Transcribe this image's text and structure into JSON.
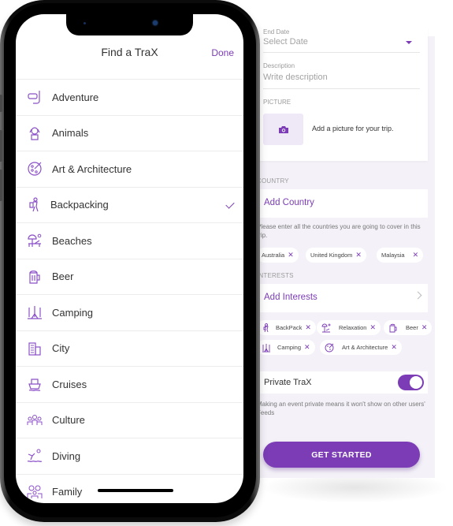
{
  "colors": {
    "accent": "#7b3cb5",
    "background": "#f4f2f8",
    "text": "#333333"
  },
  "picker": {
    "title": "Find a TraX",
    "done_label": "Done",
    "items": [
      {
        "label": "Adventure",
        "icon": "snorkel-mask-icon",
        "selected": false
      },
      {
        "label": "Animals",
        "icon": "dog-icon",
        "selected": false
      },
      {
        "label": "Art & Architecture",
        "icon": "palette-icon",
        "selected": false
      },
      {
        "label": "Backpacking",
        "icon": "backpacker-icon",
        "selected": true
      },
      {
        "label": "Beaches",
        "icon": "beach-umbrella-icon",
        "selected": false
      },
      {
        "label": "Beer",
        "icon": "beer-mug-icon",
        "selected": false
      },
      {
        "label": "Camping",
        "icon": "tent-trees-icon",
        "selected": false
      },
      {
        "label": "City",
        "icon": "buildings-icon",
        "selected": false
      },
      {
        "label": "Cruises",
        "icon": "ship-icon",
        "selected": false
      },
      {
        "label": "Culture",
        "icon": "people-group-icon",
        "selected": false
      },
      {
        "label": "Diving",
        "icon": "diver-icon",
        "selected": false
      },
      {
        "label": "Family",
        "icon": "family-icon",
        "selected": false
      }
    ]
  },
  "form": {
    "end_date": {
      "label": "End Date",
      "placeholder": "Select Date"
    },
    "description": {
      "label": "Description",
      "placeholder": "Write description"
    },
    "picture": {
      "label": "PICTURE",
      "hint": "Add a picture for your trip."
    },
    "country": {
      "label": "COUNTRY",
      "add_label": "Add Country",
      "help": "Please enter all the countries you are going to cover in this trip.",
      "chips": [
        "Australia",
        "United Kingdom",
        "Malaysia"
      ]
    },
    "interests": {
      "label": "INTERESTS",
      "add_label": "Add Interests",
      "chips": [
        {
          "label": "BackPack",
          "icon": "backpacker-icon"
        },
        {
          "label": "Relaxation",
          "icon": "beach-umbrella-icon"
        },
        {
          "label": "Beer",
          "icon": "beer-mug-icon"
        },
        {
          "label": "Camping",
          "icon": "tent-trees-icon"
        },
        {
          "label": "Art & Architecture",
          "icon": "palette-icon"
        }
      ]
    },
    "private": {
      "label": "Private TraX",
      "enabled": true,
      "help": "Making an event private means it won't show on other users' Feeds"
    },
    "cta_label": "GET STARTED"
  }
}
